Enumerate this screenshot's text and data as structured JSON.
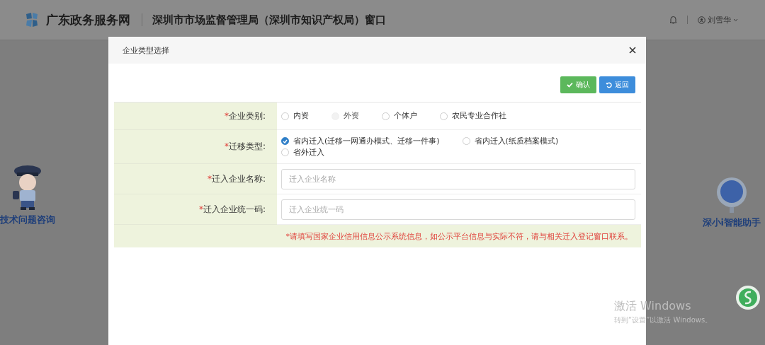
{
  "header": {
    "site_name": "广东政务服务网",
    "department": "深圳市市场监督管理局（深圳市知识产权局）窗口",
    "user": "刘雪华"
  },
  "side_helpers": [
    {
      "label": "技术问题咨询",
      "kind": "officer"
    },
    {
      "label": "深小i智能助手",
      "kind": "robot"
    }
  ],
  "dialog": {
    "title": "企业类型选择",
    "buttons": [
      {
        "label": "确认",
        "kind": "confirm"
      },
      {
        "label": "返回",
        "kind": "back"
      }
    ],
    "fields": [
      {
        "required_mark": "*",
        "label": "企业类别:",
        "kind": "radio",
        "options": [
          {
            "label": "内资",
            "selected": false,
            "disabled": false
          },
          {
            "label": "外资",
            "selected": false,
            "disabled": true
          },
          {
            "label": "个体户",
            "selected": false,
            "disabled": false
          },
          {
            "label": "农民专业合作社",
            "selected": false,
            "disabled": false
          }
        ]
      },
      {
        "required_mark": "*",
        "label": "迁移类型:",
        "kind": "radio",
        "options": [
          {
            "label": "省内迁入(迁移一网通办模式、迁移一件事)",
            "selected": true,
            "disabled": false
          },
          {
            "label": "省内迁入(纸质档案模式)",
            "selected": false,
            "disabled": false
          },
          {
            "label": "省外迁入",
            "selected": false,
            "disabled": false
          }
        ]
      },
      {
        "required_mark": "*",
        "label": "迁入企业名称:",
        "kind": "text",
        "placeholder": "迁入企业名称"
      },
      {
        "required_mark": "*",
        "label": "迁入企业统一码:",
        "kind": "text",
        "placeholder": "迁入企业统一码"
      }
    ],
    "note": "*请填写国家企业信用信息公示系统信息，如公示平台信息与实际不符，请与相关迁入登记窗口联系。"
  },
  "os_notice": {
    "title": "激活 Windows",
    "subtitle": "转到“设置”以激活 Windows。"
  }
}
